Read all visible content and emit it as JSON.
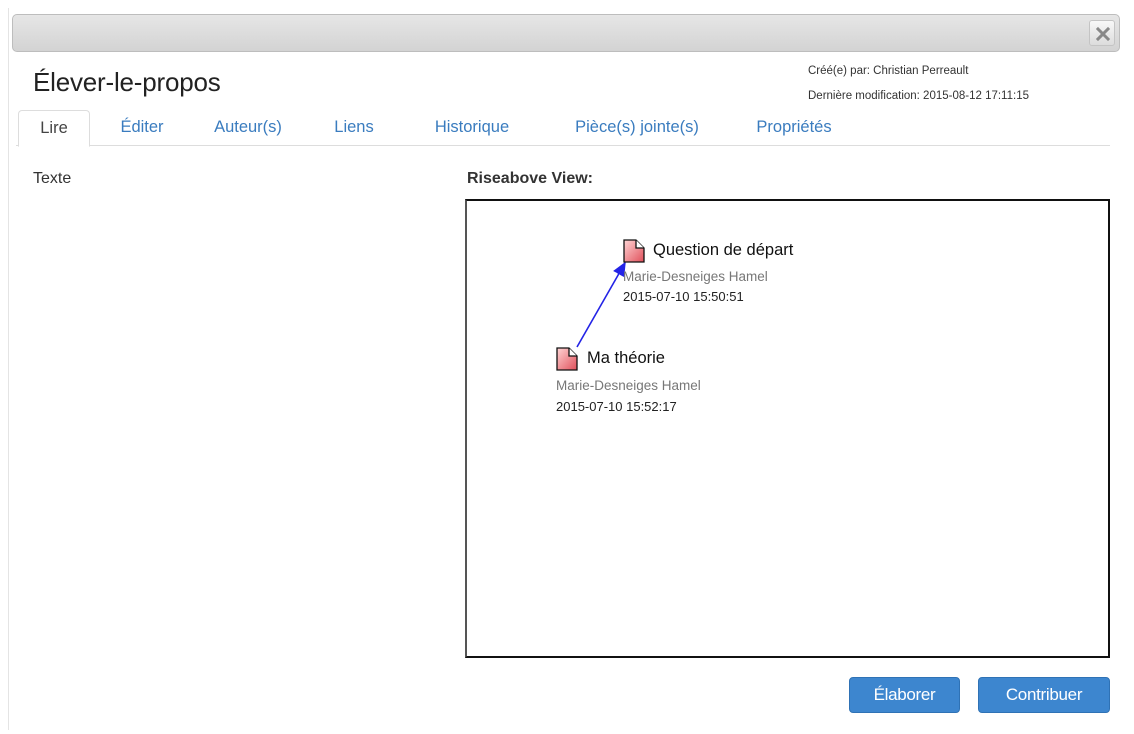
{
  "window": {
    "close_icon": "close-icon"
  },
  "page": {
    "title": "Élever-le-propos",
    "created_by": "Créé(e) par: Christian Perreault",
    "last_modified": "Dernière modification: 2015-08-12 17:11:15"
  },
  "tabs": [
    {
      "label": "Lire",
      "active": true
    },
    {
      "label": "Éditer",
      "active": false
    },
    {
      "label": "Auteur(s)",
      "active": false
    },
    {
      "label": "Liens",
      "active": false
    },
    {
      "label": "Historique",
      "active": false
    },
    {
      "label": "Pièce(s) jointe(s)",
      "active": false
    },
    {
      "label": "Propriétés",
      "active": false
    }
  ],
  "content": {
    "text_label": "Texte",
    "view_label": "Riseabove View:"
  },
  "notes": [
    {
      "title": "Question de départ",
      "author": "Marie-Desneiges Hamel",
      "date": "2015-07-10 15:50:51",
      "icon": "note-document-icon"
    },
    {
      "title": "Ma théorie",
      "author": "Marie-Desneiges Hamel",
      "date": "2015-07-10 15:52:17",
      "icon": "note-document-icon"
    }
  ],
  "link": {
    "from": "Ma théorie",
    "to": "Question de départ",
    "color": "#2323e6"
  },
  "buttons": {
    "elaborate": "Élaborer",
    "contribute": "Contribuer"
  },
  "colors": {
    "accent": "#3d86cf",
    "tab_link": "#3a7cbf",
    "note_icon": "#e85c66"
  }
}
